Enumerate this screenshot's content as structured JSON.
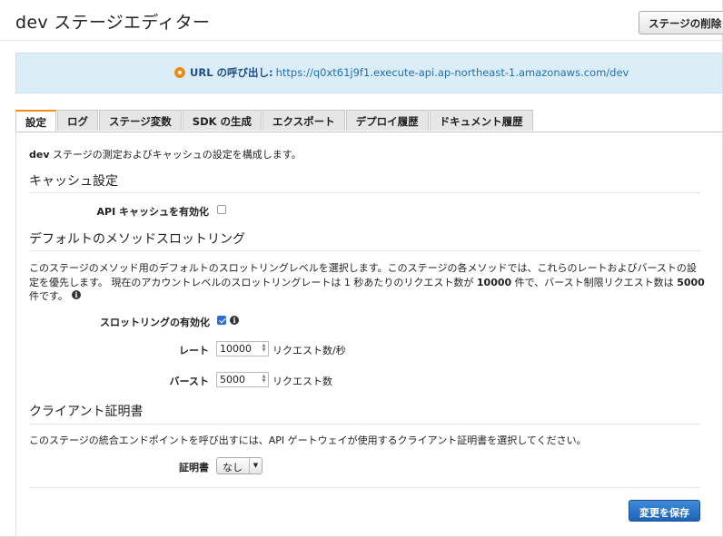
{
  "page": {
    "title": "dev ステージエディター",
    "delete_button": "ステージの削除"
  },
  "banner": {
    "label": "URL の呼び出し:",
    "url": "https://q0xt61j9f1.execute-api.ap-northeast-1.amazonaws.com/dev"
  },
  "tabs": [
    {
      "label": "設定",
      "active": true
    },
    {
      "label": "ログ"
    },
    {
      "label": "ステージ変数"
    },
    {
      "label": "SDK の生成"
    },
    {
      "label": "エクスポート"
    },
    {
      "label": "デプロイ履歴"
    },
    {
      "label": "ドキュメント履歴"
    }
  ],
  "intro": {
    "stage": "dev",
    "text": " ステージの測定およびキャッシュの設定を構成します。"
  },
  "cache": {
    "heading": "キャッシュ設定",
    "enable_label": "API キャッシュを有効化",
    "enabled": false
  },
  "throttling": {
    "heading": "デフォルトのメソッドスロットリング",
    "desc_line1": "このステージのメソッド用のデフォルトのスロットリングレベルを選択します。このステージの各メソッドでは、これらのレートおよびバーストの設",
    "desc_line2a": "定を優先します。 現在のアカウントレベルのスロットリングレートは 1 秒あたりのリクエスト数が ",
    "desc_rate": "10000",
    "desc_line2b": " 件で、バースト制限リクエスト数は ",
    "desc_burst": "5000",
    "desc_line3": "件です。",
    "enable_label": "スロットリングの有効化",
    "enabled": true,
    "rate_label": "レート",
    "rate_value": "10000",
    "rate_unit": "リクエスト数/秒",
    "burst_label": "バースト",
    "burst_value": "5000",
    "burst_unit": "リクエスト数"
  },
  "client_cert": {
    "heading": "クライアント証明書",
    "desc": "このステージの統合エンドポイントを呼び出すには、API ゲートウェイが使用するクライアント証明書を選択してください。",
    "label": "証明書",
    "selected": "なし"
  },
  "footer": {
    "save_button": "変更を保存"
  },
  "colors": {
    "accent": "#f08d17",
    "primary_button": "#1e64b8",
    "banner_bg": "#dbeef7",
    "link": "#1f6fb5"
  }
}
